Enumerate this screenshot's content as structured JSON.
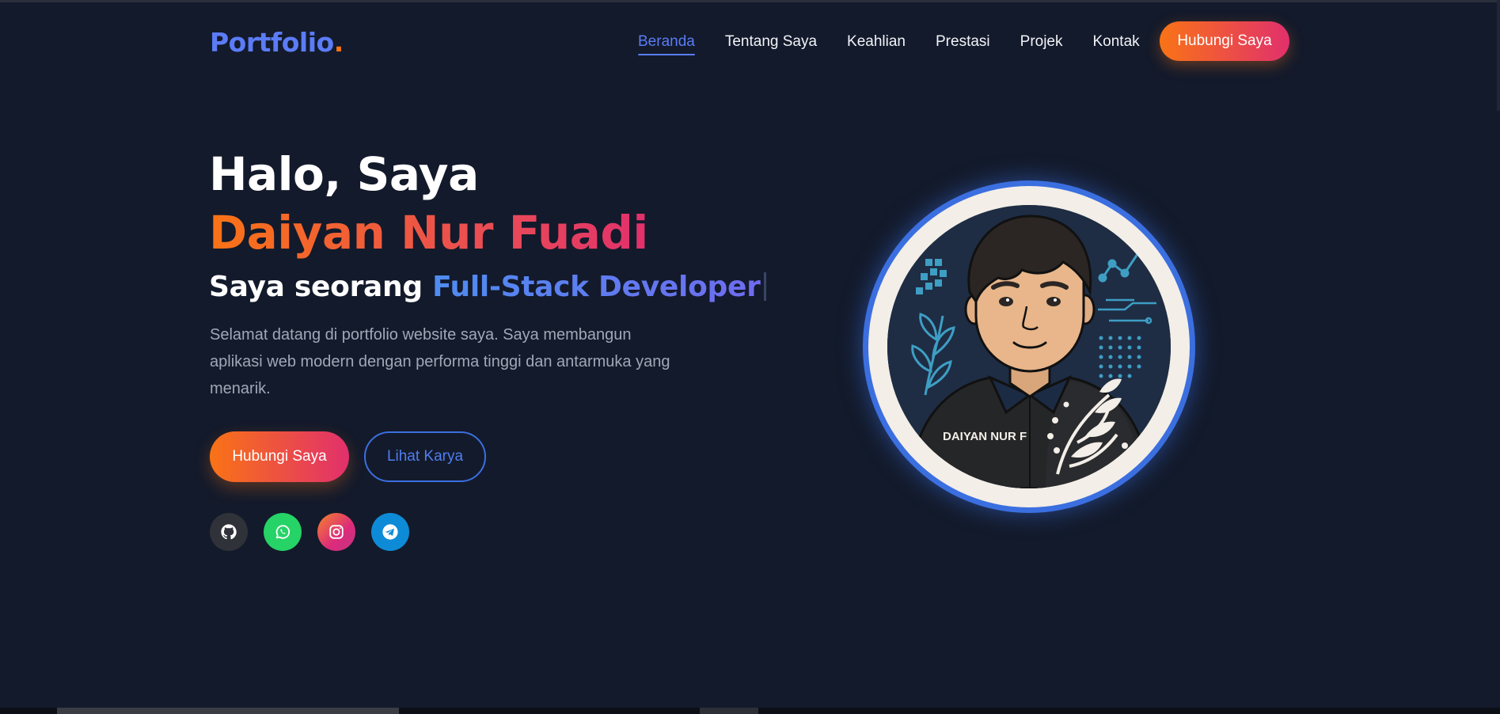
{
  "nav": {
    "logo_text": "Portfolio",
    "logo_dot": ".",
    "links": [
      {
        "label": "Beranda",
        "active": true
      },
      {
        "label": "Tentang Saya",
        "active": false
      },
      {
        "label": "Keahlian",
        "active": false
      },
      {
        "label": "Prestasi",
        "active": false
      },
      {
        "label": "Projek",
        "active": false
      },
      {
        "label": "Kontak",
        "active": false
      }
    ],
    "cta_label": "Hubungi Saya"
  },
  "hero": {
    "greeting": "Halo, Saya",
    "name": "Daiyan Nur Fuadi",
    "role_prefix": "Saya seorang",
    "role": "Full-Stack Developer",
    "description": "Selamat datang di portfolio website saya. Saya membangun aplikasi web modern dengan performa tinggi dan antarmuka yang menarik.",
    "primary_button": "Hubungi Saya",
    "secondary_button": "Lihat Karya",
    "socials": [
      {
        "name": "github",
        "icon": "github-icon",
        "color": "#2f3238"
      },
      {
        "name": "whatsapp",
        "icon": "whatsapp-icon",
        "color": "#25d366"
      },
      {
        "name": "instagram",
        "icon": "instagram-icon",
        "color": "#dd2a7b"
      },
      {
        "name": "telegram",
        "icon": "telegram-icon",
        "color": "#0e8bd6"
      }
    ]
  },
  "avatar": {
    "shirt_label": "DAIYAN NUR F"
  },
  "colors": {
    "background": "#131a2b",
    "accent_blue": "#5b7cf6",
    "accent_orange": "#f97316",
    "accent_pink": "#e1306c"
  }
}
